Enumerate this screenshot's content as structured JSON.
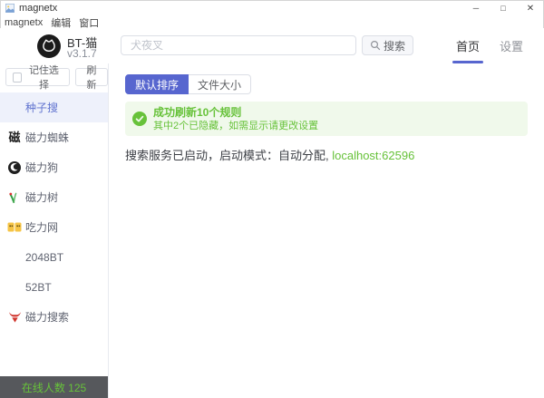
{
  "window": {
    "title": "magnetx",
    "controls": {
      "minimize": "─",
      "maximize": "□",
      "close": "✕"
    }
  },
  "menu": {
    "items": [
      "magnetx",
      "编辑",
      "窗口"
    ]
  },
  "header": {
    "app_name": "BT-猫",
    "version": "v3.1.7",
    "search_placeholder": "犬夜叉",
    "search_button": "搜索",
    "nav": [
      {
        "label": "首页",
        "active": true
      },
      {
        "label": "设置",
        "active": false
      }
    ]
  },
  "sidebar": {
    "remember_label": "记住选择",
    "refresh_label": "刷新",
    "items": [
      {
        "label": "种子搜",
        "icon": "none",
        "active": true
      },
      {
        "label": "磁力蜘蛛",
        "icon": "magnet-spider-icon",
        "icon_glyph": "磁"
      },
      {
        "label": "磁力狗",
        "icon": "magnet-dog-icon"
      },
      {
        "label": "磁力树",
        "icon": "magnet-tree-icon"
      },
      {
        "label": "吃力网",
        "icon": "chili-net-icon"
      },
      {
        "label": "2048BT",
        "icon": "none"
      },
      {
        "label": "52BT",
        "icon": "none"
      },
      {
        "label": "磁力搜索",
        "icon": "magnet-bull-icon"
      }
    ],
    "online_count": "在线人数 125"
  },
  "main": {
    "sort_tabs": [
      {
        "label": "默认排序",
        "active": true
      },
      {
        "label": "文件大小",
        "active": false
      }
    ],
    "alert": {
      "title": "成功刷新10个规则",
      "description": "其中2个已隐藏，如需显示请更改设置"
    },
    "status": {
      "prefix": "搜索服务已启动，启动模式：自动分配, ",
      "link": "localhost:62596"
    }
  },
  "colors": {
    "accent": "#5766cf",
    "success": "#67c23a",
    "alert_bg": "#f0f9eb",
    "active_item_bg": "#eef1fb",
    "footer_bg": "#56585c"
  }
}
